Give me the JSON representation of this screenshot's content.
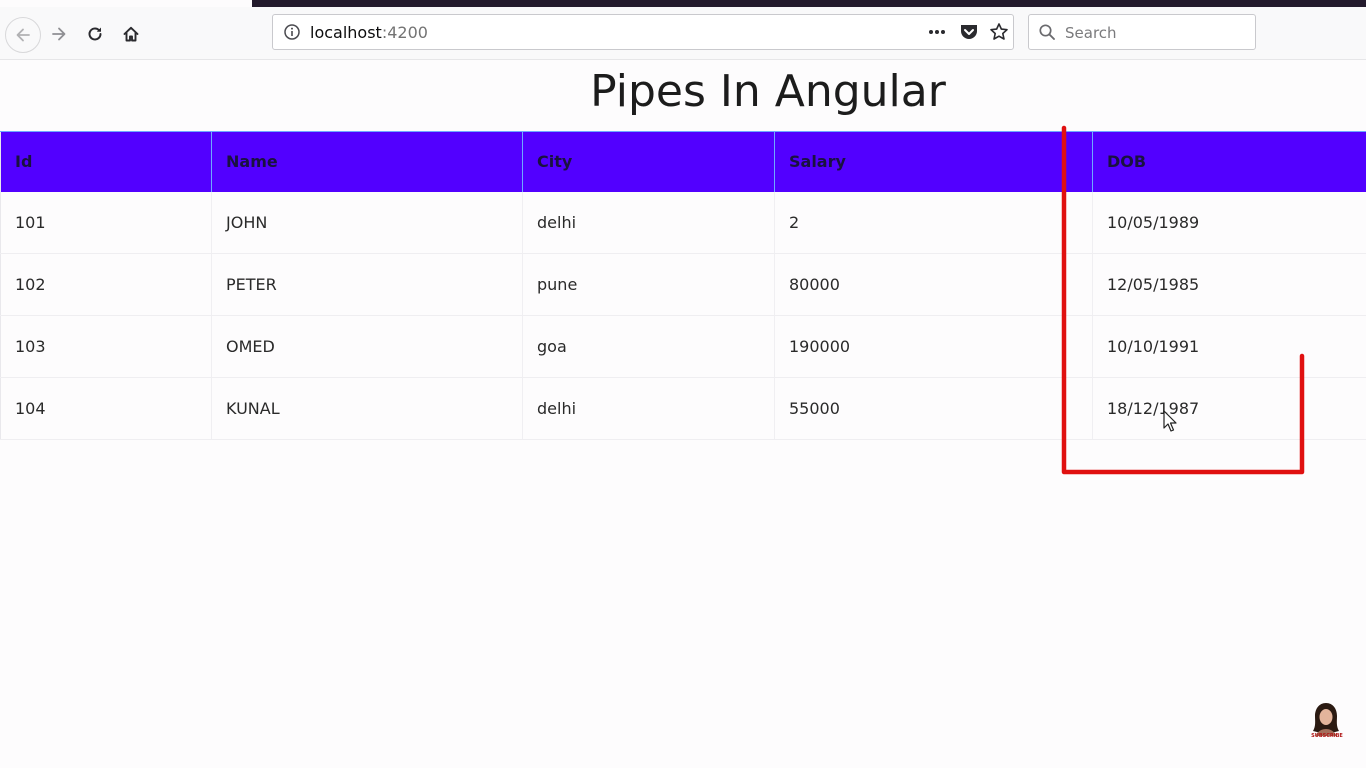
{
  "browser": {
    "url_host": "localhost",
    "url_port": ":4200",
    "search_placeholder": "Search"
  },
  "page": {
    "title": "Pipes In Angular"
  },
  "table": {
    "headers": [
      "Id",
      "Name",
      "City",
      "Salary",
      "DOB"
    ],
    "rows": [
      [
        "101",
        "JOHN",
        "delhi",
        "2",
        "10/05/1989"
      ],
      [
        "102",
        "PETER",
        "pune",
        "80000",
        "12/05/1985"
      ],
      [
        "103",
        "OMED",
        "goa",
        "190000",
        "10/10/1991"
      ],
      [
        "104",
        "KUNAL",
        "delhi",
        "55000",
        "18/12/1987"
      ]
    ]
  },
  "overlay": {
    "subscribe_label": "SUBSCRIBE"
  },
  "colors": {
    "header_bg": "#5200ff",
    "annotation": "#e01010"
  }
}
